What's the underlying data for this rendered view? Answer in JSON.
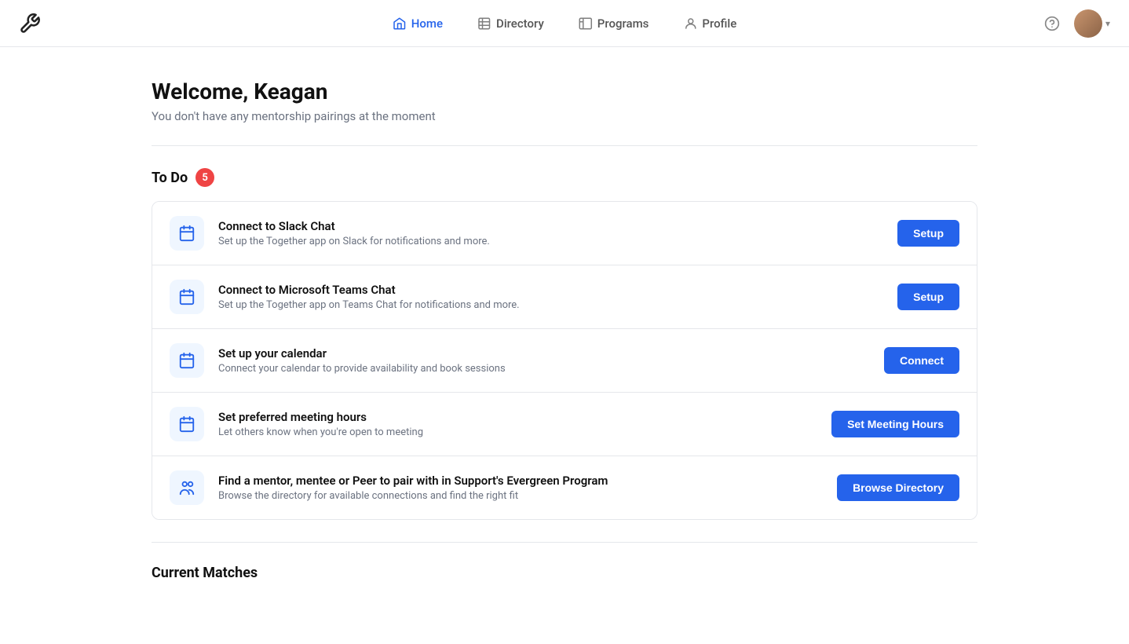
{
  "nav": {
    "logo_label": "Tools icon",
    "links": [
      {
        "id": "home",
        "label": "Home",
        "active": true
      },
      {
        "id": "directory",
        "label": "Directory",
        "active": false
      },
      {
        "id": "programs",
        "label": "Programs",
        "active": false
      },
      {
        "id": "profile",
        "label": "Profile",
        "active": false
      }
    ],
    "help_label": "?",
    "chevron_label": "▾"
  },
  "welcome": {
    "title": "Welcome, Keagan",
    "subtitle": "You don't have any mentorship pairings at the moment"
  },
  "todo": {
    "section_title": "To Do",
    "badge_count": "5",
    "tasks": [
      {
        "id": "slack",
        "title": "Connect to Slack Chat",
        "desc": "Set up the Together app on Slack for notifications and more.",
        "btn_label": "Setup"
      },
      {
        "id": "teams",
        "title": "Connect to Microsoft Teams Chat",
        "desc": "Set up the Together app on Teams Chat for notifications and more.",
        "btn_label": "Setup"
      },
      {
        "id": "calendar",
        "title": "Set up your calendar",
        "desc": "Connect your calendar to provide availability and book sessions",
        "btn_label": "Connect"
      },
      {
        "id": "meeting-hours",
        "title": "Set preferred meeting hours",
        "desc": "Let others know when you're open to meeting",
        "btn_label": "Set Meeting Hours"
      },
      {
        "id": "directory",
        "title": "Find a mentor, mentee or Peer to pair with in Support's Evergreen Program",
        "desc": "Browse the directory for available connections and find the right fit",
        "btn_label": "Browse Directory"
      }
    ]
  },
  "current_matches": {
    "title": "Current Matches"
  }
}
